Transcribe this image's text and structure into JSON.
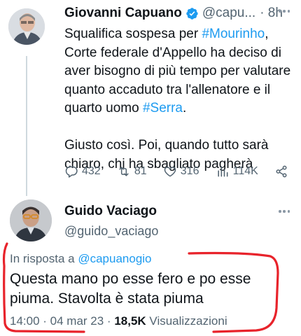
{
  "tweet1": {
    "author_name": "Giovanni Capuano",
    "handle": "@capu...",
    "time": "8h",
    "body_lines": [
      [
        "Squalifica sospesa per ",
        "#Mourinho",
        ","
      ],
      [
        "Corte federale d'Appello ha deciso di"
      ],
      [
        "aver bisogno di più tempo per valutare"
      ],
      [
        "quanto accaduto tra l'allenatore e il"
      ],
      [
        "quarto uomo ",
        "#Serra",
        "."
      ],
      [
        ""
      ],
      [
        "Giusto così. Poi, quando tutto sarà"
      ],
      [
        "chiaro, chi ha sbagliato pagherà"
      ]
    ],
    "replies": "432",
    "retweets": "81",
    "likes": "316",
    "views": "114K",
    "icons": {
      "verified": "verified-badge-icon",
      "reply": "reply-icon",
      "retweet": "retweet-icon",
      "like": "heart-icon",
      "views": "views-icon",
      "share": "share-icon",
      "more": "more-icon"
    }
  },
  "tweet2": {
    "author_name": "Guido Vaciago",
    "handle": "@guido_vaciago",
    "reply_prefix": "In risposta a ",
    "reply_mention": "@capuanogio",
    "body_lines": [
      "Questa mano po esse fero e po esse",
      "piuma. Stavolta è stata piuma"
    ],
    "time": "14:00 · 04 mar 23 · ",
    "views_count": "18,5K",
    "views_label": " Visualizzazioni"
  },
  "colors": {
    "accent": "#1d9bf0",
    "text_primary": "#0f1419",
    "text_secondary": "#536471",
    "annotation": "#e8232b"
  }
}
